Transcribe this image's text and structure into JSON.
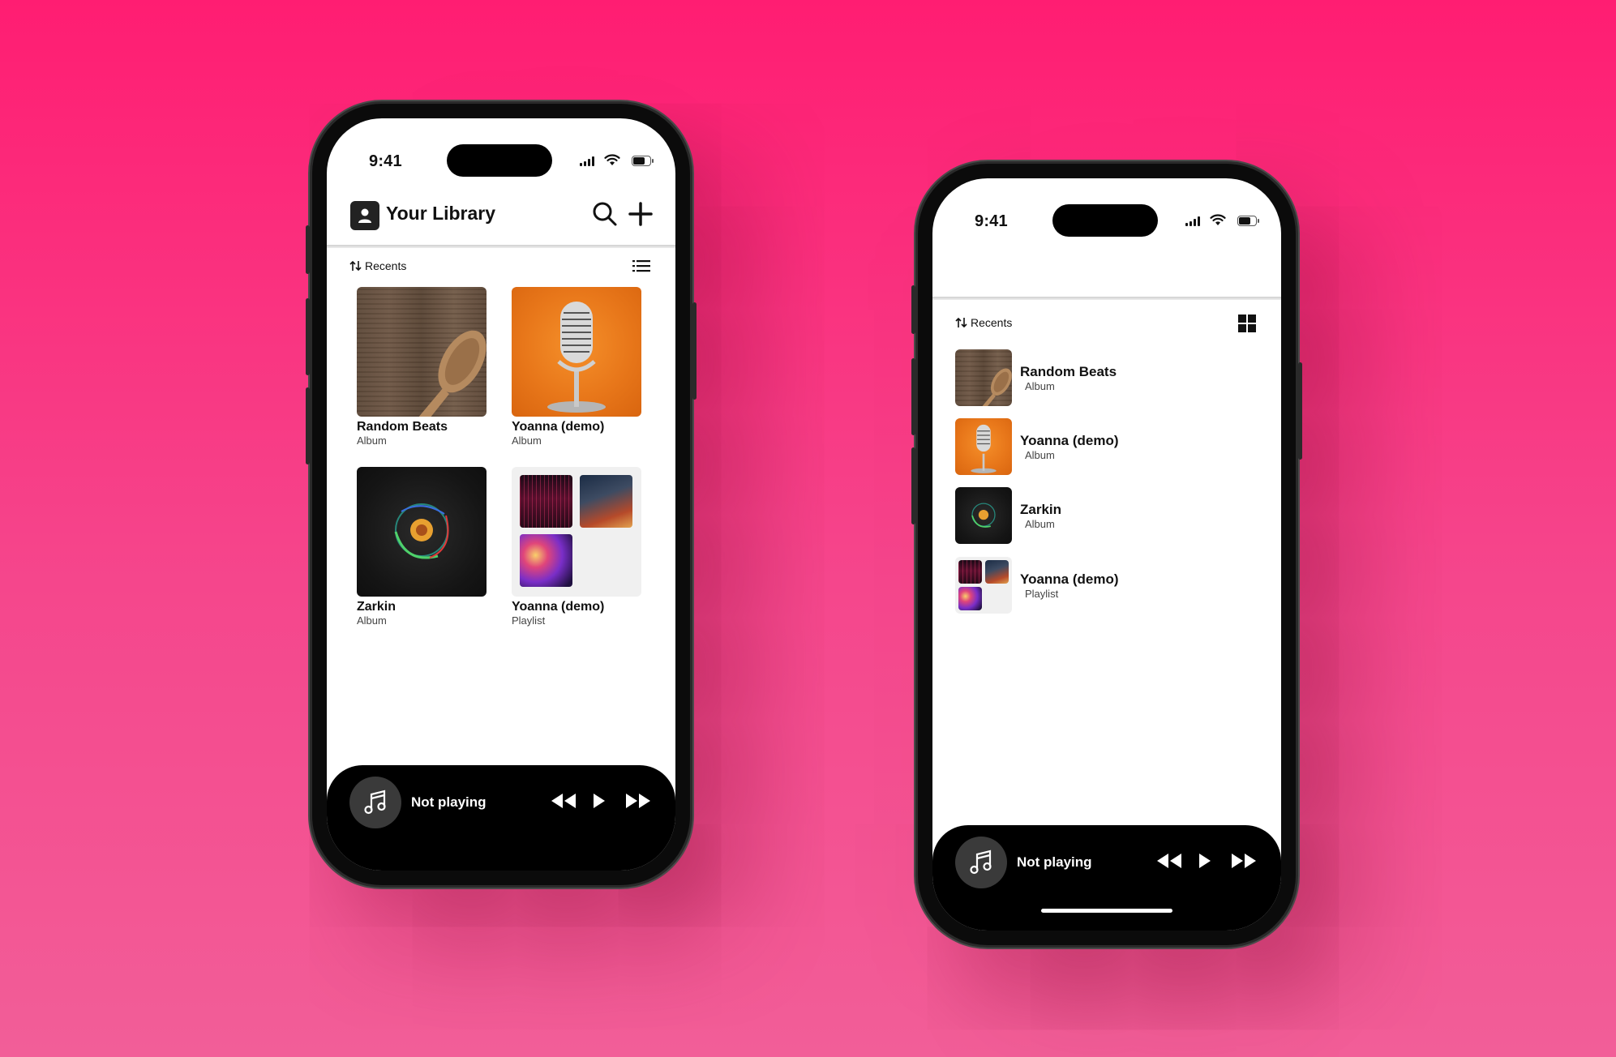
{
  "status_bar": {
    "time": "9:41"
  },
  "library": {
    "title": "Your Library",
    "sort_label": "Recents",
    "items": [
      {
        "title": "Random Beats",
        "subtitle": "Album",
        "art": "wooden-spoon"
      },
      {
        "title": "Yoanna (demo)",
        "subtitle": "Album",
        "art": "microphone"
      },
      {
        "title": "Zarkin",
        "subtitle": "Album",
        "art": "dark-swirl"
      },
      {
        "title": "Yoanna (demo)",
        "subtitle": "Playlist",
        "art": "playlist-collage"
      }
    ]
  },
  "player": {
    "status": "Not playing"
  },
  "icons": {
    "header": [
      "profile-icon",
      "search-icon",
      "plus-icon"
    ],
    "sort": "sort-arrows-icon",
    "view_toggles": [
      "list-view-icon",
      "grid-view-icon"
    ],
    "player": [
      "music-note-icon",
      "rewind-icon",
      "play-icon",
      "fast-forward-icon"
    ]
  },
  "colors": {
    "background_top": "#ff1d72",
    "background_bottom": "#f25e98",
    "player_bg": "#000000"
  }
}
